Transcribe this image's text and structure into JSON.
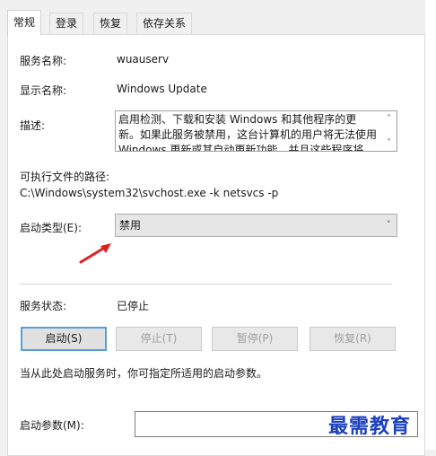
{
  "tabs": [
    {
      "label": "常规",
      "active": true
    },
    {
      "label": "登录",
      "active": false
    },
    {
      "label": "恢复",
      "active": false
    },
    {
      "label": "依存关系",
      "active": false
    }
  ],
  "service_name": {
    "label": "服务名称:",
    "value": "wuauserv"
  },
  "display_name": {
    "label": "显示名称:",
    "value": "Windows Update"
  },
  "description": {
    "label": "描述:",
    "value": "启用检测、下载和安装 Windows 和其他程序的更新。如果此服务被禁用，这台计算机的用户将无法使用 Windows 更新或其自动更新功能，并且这些程序将"
  },
  "executable_path": {
    "label": "可执行文件的路径:",
    "value": "C:\\Windows\\system32\\svchost.exe -k netsvcs -p"
  },
  "startup_type": {
    "label": "启动类型(E):",
    "value": "禁用"
  },
  "service_status": {
    "label": "服务状态:",
    "value": "已停止"
  },
  "buttons": {
    "start": "启动(S)",
    "stop": "停止(T)",
    "pause": "暂停(P)",
    "resume": "恢复(R)"
  },
  "hint_text": "当从此处启动服务时，你可指定所适用的启动参数。",
  "start_params": {
    "label": "启动参数(M):",
    "value": ""
  },
  "watermark": "最需教育",
  "colors": {
    "arrow": "#e02020",
    "watermark": "#1a3fbf",
    "focus_border": "#5a9fd4"
  }
}
